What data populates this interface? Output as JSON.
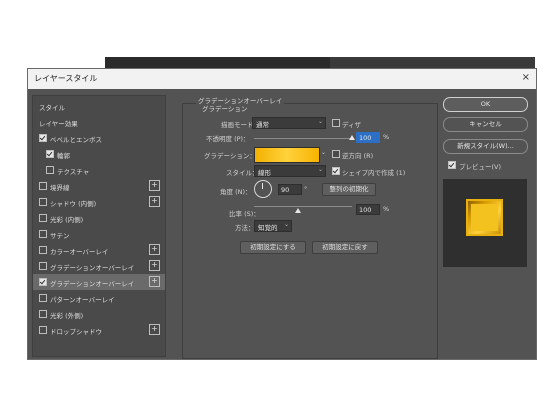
{
  "dialog": {
    "title": "レイヤースタイル",
    "close_symbol": "×"
  },
  "left_panel": {
    "items": [
      {
        "label": "スタイル",
        "checkbox": false,
        "checked": false,
        "has_plus": false,
        "selected": false
      },
      {
        "label": "レイヤー効果",
        "checkbox": false,
        "checked": false,
        "has_plus": false,
        "selected": false
      },
      {
        "label": "ベベルとエンボス",
        "checkbox": true,
        "checked": true,
        "has_plus": false,
        "selected": false
      },
      {
        "label": "輪郭",
        "checkbox": true,
        "checked": true,
        "has_plus": false,
        "selected": false,
        "sub": true
      },
      {
        "label": "テクスチャ",
        "checkbox": true,
        "checked": false,
        "has_plus": false,
        "selected": false,
        "sub": true
      },
      {
        "label": "境界線",
        "checkbox": true,
        "checked": false,
        "has_plus": true,
        "selected": false
      },
      {
        "label": "シャドウ (内側)",
        "checkbox": true,
        "checked": false,
        "has_plus": true,
        "selected": false
      },
      {
        "label": "光彩 (内側)",
        "checkbox": true,
        "checked": false,
        "has_plus": false,
        "selected": false
      },
      {
        "label": "サテン",
        "checkbox": true,
        "checked": false,
        "has_plus": false,
        "selected": false
      },
      {
        "label": "カラーオーバーレイ",
        "checkbox": true,
        "checked": false,
        "has_plus": true,
        "selected": false
      },
      {
        "label": "グラデーションオーバーレイ",
        "checkbox": true,
        "checked": false,
        "has_plus": true,
        "selected": false
      },
      {
        "label": "グラデーションオーバーレイ",
        "checkbox": true,
        "checked": true,
        "has_plus": true,
        "selected": true
      },
      {
        "label": "パターンオーバーレイ",
        "checkbox": true,
        "checked": false,
        "has_plus": false,
        "selected": false
      },
      {
        "label": "光彩 (外側)",
        "checkbox": true,
        "checked": false,
        "has_plus": false,
        "selected": false
      },
      {
        "label": "ドロップシャドウ",
        "checkbox": true,
        "checked": false,
        "has_plus": true,
        "selected": false
      }
    ]
  },
  "settings": {
    "group_title": "グラデーションオーバーレイ",
    "subgroup_title": "グラデーション",
    "blend_mode_label": "描画モード：",
    "blend_mode_value": "通常",
    "dither_label": "ディザ",
    "opacity_label": "不透明度 (P)：",
    "opacity_value": "100",
    "opacity_fraction": 1.0,
    "percent": "%",
    "gradient_label": "グラデーション：",
    "reverse_label": "逆方向 (R)",
    "style_label": "スタイル：",
    "style_value": "線形",
    "align_label": "シェイプ内で作成 (1)",
    "angle_label": "角度 (N)：",
    "angle_value": "90",
    "degree": "°",
    "reset_align_button": "整列の初期化",
    "scale_label": "比率 (S)：",
    "scale_value": "100",
    "scale_fraction": 0.45,
    "method_label": "方法：",
    "method_value": "知覚的",
    "make_default_button": "初期設定にする",
    "reset_default_button": "初期設定に戻す"
  },
  "right_panel": {
    "ok": "OK",
    "cancel": "キャンセル",
    "new_style": "新規スタイル(W)...",
    "preview_label": "プレビュー(V)"
  },
  "colors": {
    "dialog_bg": "#535353",
    "gradient_start": "#f2b100",
    "gradient_mid": "#ffd23d",
    "accent_blue": "#2d6fc4"
  }
}
